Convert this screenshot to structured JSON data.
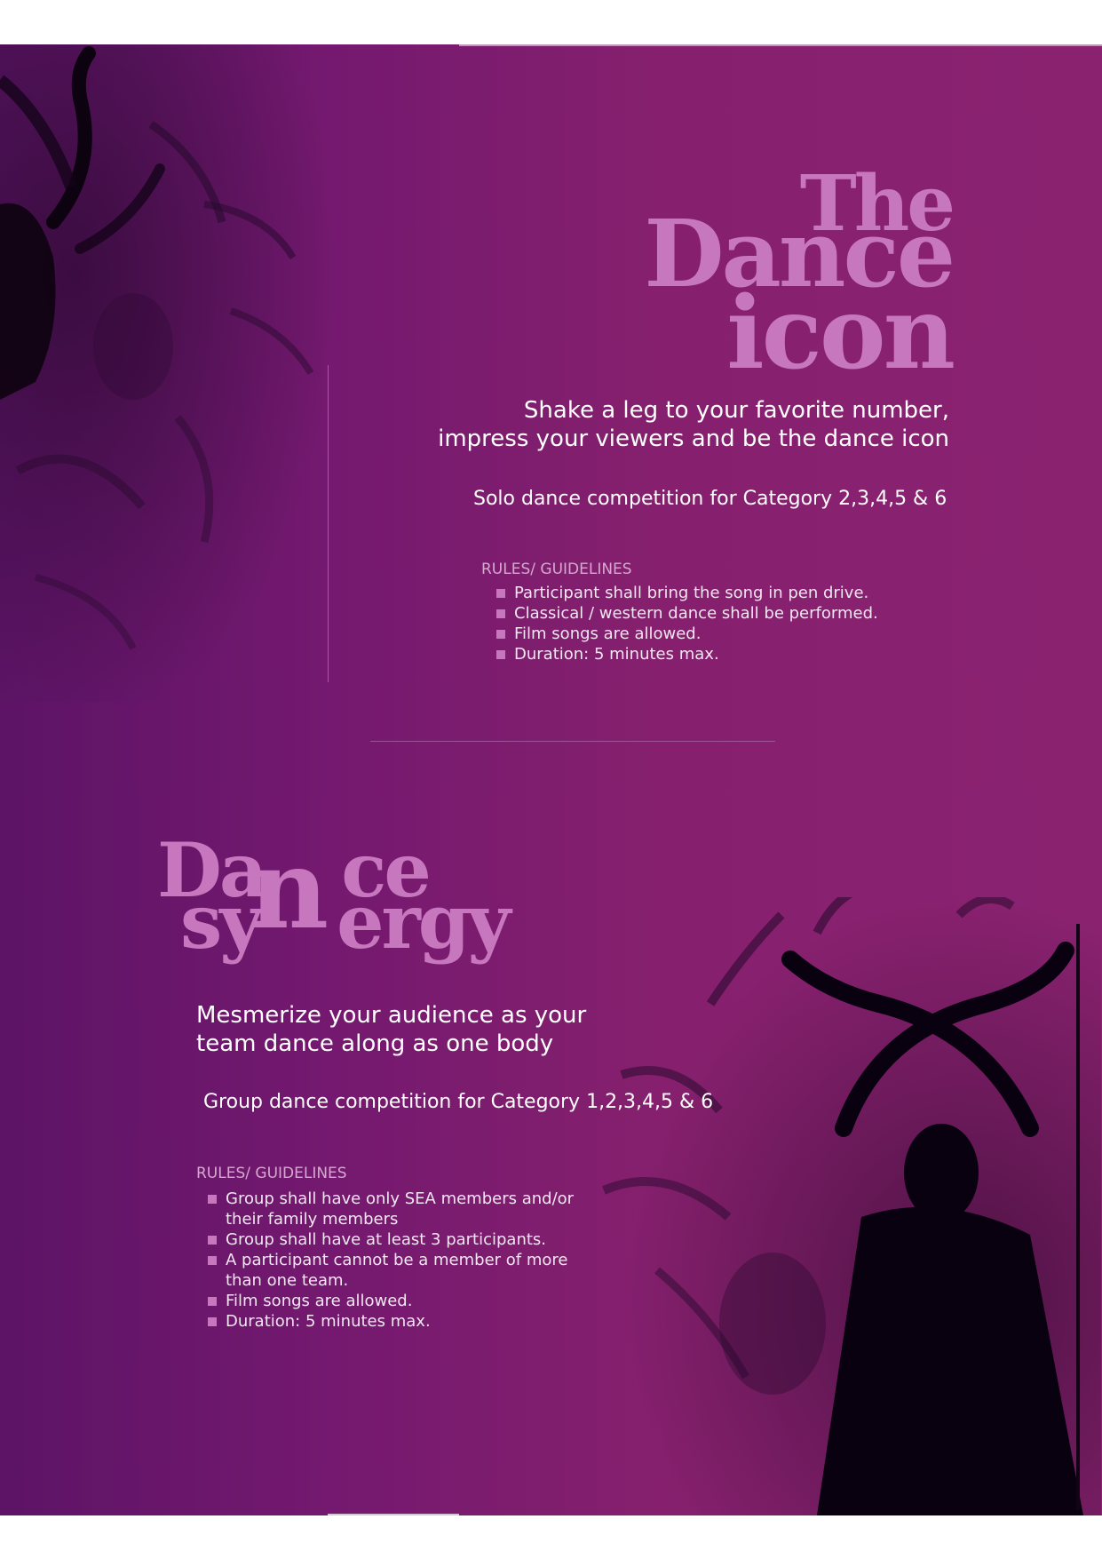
{
  "section_solo": {
    "title_line1": "The",
    "title_line2": "Dance",
    "title_line3": "icon",
    "tagline_line1": "Shake a leg to your favorite number,",
    "tagline_line2": "impress your viewers and be the dance icon",
    "category": "Solo dance competition for Category  2,3,4,5 & 6",
    "rules_heading": "RULES/ GUIDELINES",
    "rules": [
      "Participant shall bring the song in pen drive.",
      "Classical / western dance shall be performed.",
      "Film songs are allowed.",
      "Duration: 5 minutes max."
    ]
  },
  "section_group": {
    "title_part1": "Da",
    "title_part2": "ce",
    "title_n": "n",
    "title_part3": "sy",
    "title_part4": "ergy",
    "tagline_line1": "Mesmerize your audience as your",
    "tagline_line2": "team dance along as one body",
    "category": "Group dance competition for Category 1,2,3,4,5 & 6",
    "rules_heading": "RULES/ GUIDELINES",
    "rules": [
      "Group shall have only SEA members and/or their family members",
      "Group shall have at least 3 participants.",
      "A participant cannot be a member of more than one team.",
      "Film songs are allowed.",
      "Duration: 5 minutes max."
    ]
  },
  "colors": {
    "background": "#7a1a6e",
    "title_accent": "#c777bd",
    "bullet": "#c777bd"
  }
}
